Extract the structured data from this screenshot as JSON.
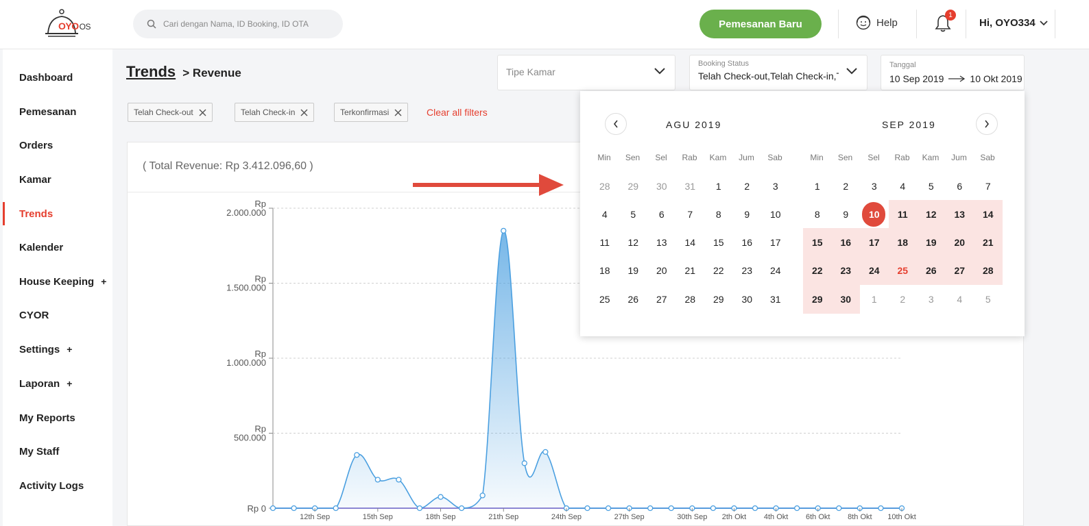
{
  "header": {
    "logo_brand": "OYO",
    "logo_suffix": "OS",
    "search_placeholder": "Cari dengan Nama, ID Booking, ID OTA",
    "new_booking_label": "Pemesanan Baru",
    "help_label": "Help",
    "notification_count": "1",
    "user_label": "Hi, OYO334"
  },
  "sidebar": {
    "items": [
      {
        "label": "Dashboard"
      },
      {
        "label": "Pemesanan"
      },
      {
        "label": "Orders"
      },
      {
        "label": "Kamar"
      },
      {
        "label": "Trends",
        "active": true
      },
      {
        "label": "Kalender"
      },
      {
        "label": "House Keeping",
        "expand": "+"
      },
      {
        "label": "CYOR"
      },
      {
        "label": "Settings",
        "expand": "+"
      },
      {
        "label": "Laporan",
        "expand": "+"
      },
      {
        "label": "My Reports"
      },
      {
        "label": "My Staff"
      },
      {
        "label": "Activity Logs"
      }
    ]
  },
  "page": {
    "title": "Trends",
    "subtitle": "> Revenue",
    "total_revenue": "( Total Revenue: Rp 3.412.096,60 )"
  },
  "filters": {
    "room_type": {
      "label": "Tipe Kamar"
    },
    "booking_status": {
      "label": "Booking Status",
      "value": "Telah Check-out,Telah Check-in,Terkonfirmasi"
    },
    "date": {
      "label": "Tanggal",
      "start": "10 Sep 2019",
      "end": "10 Okt 2019"
    },
    "chips": [
      {
        "label": "Telah Check-out"
      },
      {
        "label": "Telah Check-in"
      },
      {
        "label": "Terkonfirmasi"
      }
    ],
    "clear_label": "Clear all filters"
  },
  "calendar": {
    "weekdays": [
      "Min",
      "Sen",
      "Sel",
      "Rab",
      "Kam",
      "Jum",
      "Sab"
    ],
    "months": [
      {
        "title": "AGU 2019",
        "weeks": [
          [
            {
              "d": "28",
              "m": 1
            },
            {
              "d": "29",
              "m": 1
            },
            {
              "d": "30",
              "m": 1
            },
            {
              "d": "31",
              "m": 1
            },
            {
              "d": "1"
            },
            {
              "d": "2"
            },
            {
              "d": "3"
            }
          ],
          [
            {
              "d": "4"
            },
            {
              "d": "5"
            },
            {
              "d": "6"
            },
            {
              "d": "7"
            },
            {
              "d": "8"
            },
            {
              "d": "9"
            },
            {
              "d": "10"
            }
          ],
          [
            {
              "d": "11"
            },
            {
              "d": "12"
            },
            {
              "d": "13"
            },
            {
              "d": "14"
            },
            {
              "d": "15"
            },
            {
              "d": "16"
            },
            {
              "d": "17"
            }
          ],
          [
            {
              "d": "18"
            },
            {
              "d": "19"
            },
            {
              "d": "20"
            },
            {
              "d": "21"
            },
            {
              "d": "22"
            },
            {
              "d": "23"
            },
            {
              "d": "24"
            }
          ],
          [
            {
              "d": "25"
            },
            {
              "d": "26"
            },
            {
              "d": "27"
            },
            {
              "d": "28"
            },
            {
              "d": "29"
            },
            {
              "d": "30"
            },
            {
              "d": "31"
            }
          ]
        ]
      },
      {
        "title": "SEP 2019",
        "weeks": [
          [
            {
              "d": "1"
            },
            {
              "d": "2"
            },
            {
              "d": "3"
            },
            {
              "d": "4"
            },
            {
              "d": "5"
            },
            {
              "d": "6"
            },
            {
              "d": "7"
            }
          ],
          [
            {
              "d": "8"
            },
            {
              "d": "9"
            },
            {
              "d": "10",
              "s": 1
            },
            {
              "d": "11",
              "r": 1
            },
            {
              "d": "12",
              "r": 1
            },
            {
              "d": "13",
              "r": 1
            },
            {
              "d": "14",
              "r": 1
            }
          ],
          [
            {
              "d": "15",
              "r": 1
            },
            {
              "d": "16",
              "r": 1
            },
            {
              "d": "17",
              "r": 1
            },
            {
              "d": "18",
              "r": 1
            },
            {
              "d": "19",
              "r": 1
            },
            {
              "d": "20",
              "r": 1
            },
            {
              "d": "21",
              "r": 1
            }
          ],
          [
            {
              "d": "22",
              "r": 1
            },
            {
              "d": "23",
              "r": 1
            },
            {
              "d": "24",
              "r": 1
            },
            {
              "d": "25",
              "r": 1,
              "t": 1
            },
            {
              "d": "26",
              "r": 1
            },
            {
              "d": "27",
              "r": 1
            },
            {
              "d": "28",
              "r": 1
            }
          ],
          [
            {
              "d": "29",
              "r": 1
            },
            {
              "d": "30",
              "r": 1
            },
            {
              "d": "1",
              "m": 1
            },
            {
              "d": "2",
              "m": 1
            },
            {
              "d": "3",
              "m": 1
            },
            {
              "d": "4",
              "m": 1
            },
            {
              "d": "5",
              "m": 1
            }
          ]
        ]
      }
    ]
  },
  "chart_data": {
    "type": "area",
    "title": "",
    "xlabel": "",
    "ylabel": "",
    "ylim": [
      0,
      2000000
    ],
    "y_ticks": [
      {
        "value": 0,
        "label": "Rp 0"
      },
      {
        "value": 500000,
        "label": "Rp\n500.000"
      },
      {
        "value": 1000000,
        "label": "Rp\n1.000.000"
      },
      {
        "value": 1500000,
        "label": "Rp\n1.500.000"
      },
      {
        "value": 2000000,
        "label": "Rp\n2.000.000"
      }
    ],
    "x": [
      "10th Sep",
      "11th Sep",
      "12th Sep",
      "13th Sep",
      "14th Sep",
      "15th Sep",
      "16th Sep",
      "17th Sep",
      "18th Sep",
      "19th Sep",
      "20th Sep",
      "21th Sep",
      "22th Sep",
      "23th Sep",
      "24th Sep",
      "25th Sep",
      "26th Sep",
      "27th Sep",
      "28th Sep",
      "29th Sep",
      "30th Sep",
      "1th Okt",
      "2th Okt",
      "3th Okt",
      "4th Okt",
      "5th Okt",
      "6th Okt",
      "7th Okt",
      "8th Okt",
      "9th Okt",
      "10th Okt"
    ],
    "x_tick_labels": [
      "12th Sep",
      "15th Sep",
      "18th Sep",
      "21th Sep",
      "24th Sep",
      "27th Sep",
      "30th Sep",
      "2th Okt",
      "4th Okt",
      "6th Okt",
      "8th Okt",
      "10th Okt"
    ],
    "series": [
      {
        "values": [
          0,
          0,
          0,
          0,
          355000,
          190000,
          190000,
          0,
          75000,
          0,
          85000,
          1850000,
          300000,
          375000,
          0,
          0,
          0,
          0,
          0,
          0,
          0,
          0,
          0,
          0,
          0,
          0,
          0,
          0,
          0,
          0,
          0
        ],
        "color": "#4a9fe0"
      },
      {
        "values": [
          0,
          0,
          0,
          0,
          0,
          0,
          0,
          0,
          0,
          0,
          0,
          0,
          0,
          0,
          0,
          0,
          0,
          0,
          0,
          0,
          0,
          0,
          0,
          0,
          0,
          0,
          0,
          0,
          0,
          0,
          0
        ],
        "color": "#9b7fd1"
      }
    ],
    "grid": true,
    "legend": "none"
  },
  "colors": {
    "brand_red": "#e53e2e",
    "green": "#6ab04c",
    "range_bg": "#fbe4e2"
  }
}
